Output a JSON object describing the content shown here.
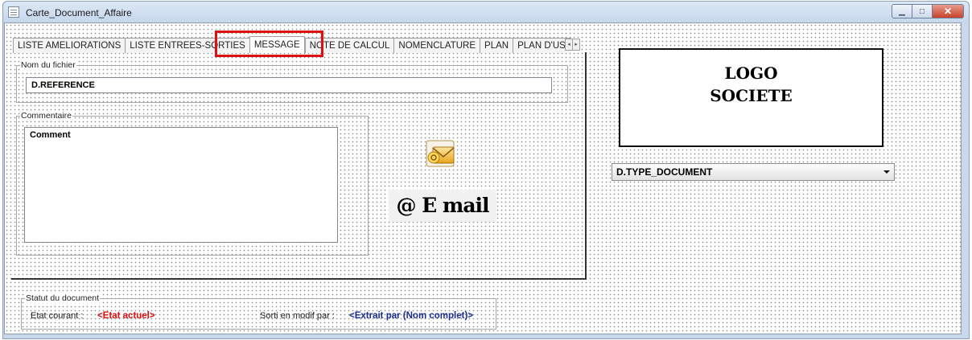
{
  "window": {
    "title": "Carte_Document_Affaire",
    "controls": [
      "▁",
      "□",
      "✕"
    ]
  },
  "tabs": [
    {
      "label": "LISTE AMELIORATIONS",
      "active": false
    },
    {
      "label": "LISTE ENTREES-SORTIES",
      "active": false
    },
    {
      "label": "MESSAGE",
      "active": true
    },
    {
      "label": "NOTE DE CALCUL",
      "active": false
    },
    {
      "label": "NOMENCLATURE",
      "active": false
    },
    {
      "label": "PLAN",
      "active": false
    },
    {
      "label": "PLAN D'USINAGE",
      "active": false
    }
  ],
  "tab_scroll": {
    "left": "◂",
    "right": "▸"
  },
  "message_tab": {
    "file_group_label": "Nom du fichier",
    "file_value": "D.REFERENCE",
    "comment_group_label": "Commentaire",
    "comment_value": "Comment",
    "email_label": "@ E mail"
  },
  "logo": {
    "line1": "LOGO",
    "line2": "SOCIETE"
  },
  "type_combo": {
    "value": "D.TYPE_DOCUMENT"
  },
  "status": {
    "group_label": "Statut du document",
    "current_label": "Etat courant :",
    "current_value": "<Etat actuel>",
    "checked_out_label": "Sorti en modif par :",
    "checked_out_value": "<Extrait par (Nom complet)>"
  },
  "colors": {
    "highlight": "#e01010",
    "status_red": "#e01010",
    "status_blue": "#1b2e8c"
  }
}
